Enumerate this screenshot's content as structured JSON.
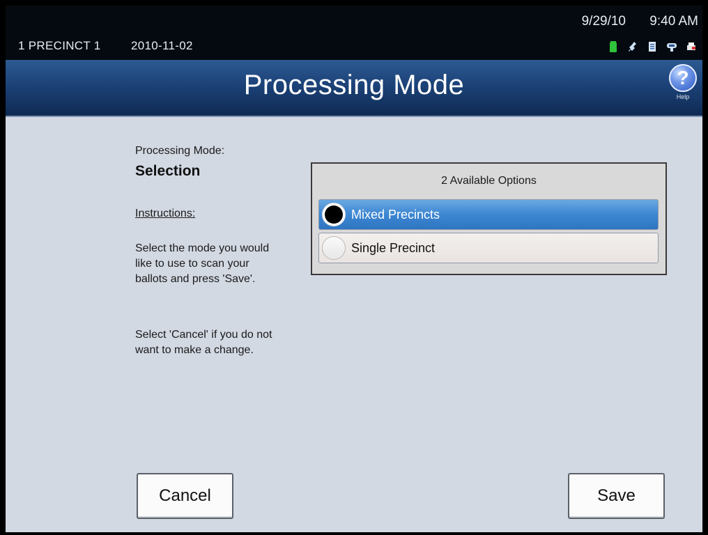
{
  "status_bar": {
    "precinct": "1 PRECINCT 1",
    "election_date": "2010-11-02",
    "date": "9/29/10",
    "time": "9:40 AM",
    "icons": [
      "battery-icon",
      "power-plug-icon",
      "document-icon",
      "network-icon",
      "printer-icon"
    ]
  },
  "header": {
    "title": "Processing Mode",
    "help_label": "Help",
    "help_glyph": "?"
  },
  "panel": {
    "mode_label": "Processing Mode:",
    "mode_value": "Selection",
    "instructions_heading": "Instructions:",
    "instructions_1": "Select the mode you would like to use to scan your ballots and press 'Save'.",
    "instructions_2": "Select 'Cancel' if you do not want to make a change."
  },
  "options": {
    "header": "2 Available Options",
    "items": [
      {
        "label": "Mixed Precincts",
        "selected": true
      },
      {
        "label": "Single Precinct",
        "selected": false
      }
    ]
  },
  "buttons": {
    "cancel": "Cancel",
    "save": "Save"
  },
  "colors": {
    "title_bar": "#1c4278",
    "selected_option": "#3c86d2",
    "background": "#d3d9e3"
  }
}
